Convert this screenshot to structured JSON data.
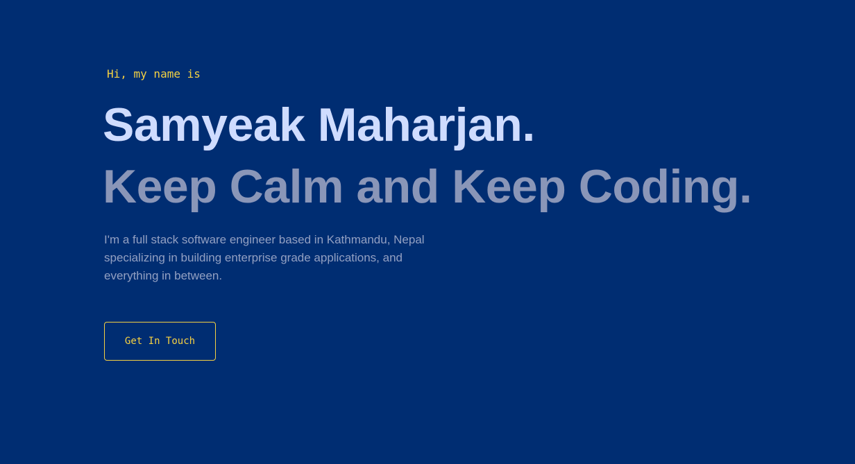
{
  "hero": {
    "intro": "Hi, my name is",
    "name": "Samyeak Maharjan.",
    "tagline": "Keep Calm and Keep Coding.",
    "bio": "I'm a full stack software engineer based in Kathmandu, Nepal specializing in building enterprise grade applications, and everything in between.",
    "cta_label": "Get In Touch"
  },
  "colors": {
    "background": "#002d72",
    "accent": "#f5d142",
    "name": "#cfdcff",
    "tagline": "#8a96b8",
    "bio": "#93a0c2"
  }
}
